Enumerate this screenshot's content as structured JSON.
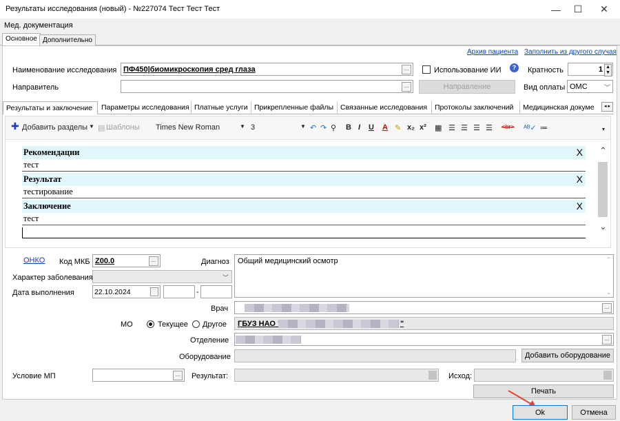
{
  "window": {
    "title": "Результаты исследования (новый) - №227074 Тест Тест Тест"
  },
  "menu": {
    "label": "Мед. документация"
  },
  "top_tabs": [
    "Основное",
    "Дополнительно"
  ],
  "links": {
    "archive": "Архив пациента",
    "fill_from": "Заполнить из другого случая"
  },
  "form": {
    "research_label": "Наименование исследования",
    "research_value": "ПФ450|биомикроскопия сред глаза",
    "ai_label": "Использование ИИ",
    "multiplicity_label": "Кратность",
    "multiplicity_value": "1",
    "referrer_label": "Направитель",
    "direction_btn": "Направление",
    "payment_label": "Вид оплаты",
    "payment_value": "ОМС"
  },
  "content_tabs": [
    "Результаты и заключение",
    "Параметры исследования",
    "Платные услуги",
    "Прикрепленные файлы",
    "Связанные исследования",
    "Протоколы заключений",
    "Медицинская докуме"
  ],
  "toolbar": {
    "add_sections": "Добавить разделы",
    "templates": "Шаблоны",
    "font": "Times New Roman",
    "size": "3"
  },
  "sections": [
    {
      "title": "Рекомендации",
      "text": "тест"
    },
    {
      "title": "Результат",
      "text": "тестирование"
    },
    {
      "title": "Заключение",
      "text": "тест"
    }
  ],
  "close_glyph": "X",
  "bottom": {
    "onko": "ОНКО",
    "mkb_label": "Код МКБ",
    "mkb_value": "Z00.0",
    "diagnosis_label": "Диагноз",
    "diagnosis_value": "Общий медицинский осмотр",
    "disease_char_label": "Характер заболевания",
    "date_label": "Дата выполнения",
    "date_value": "22.10.2024",
    "date_dash": "-",
    "doctor_label": "Врач",
    "mo_label": "МО",
    "mo_current": "Текущее",
    "mo_other": "Другое",
    "mo_value_prefix": "ГБУЗ НАО \"",
    "mo_value_suffix": "\"",
    "department_label": "Отделение",
    "equipment_label": "Оборудование",
    "add_equipment_btn": "Добавить оборудование",
    "condition_label": "Условие МП",
    "result_label": "Результат:",
    "outcome_label": "Исход:",
    "print_btn": "Печать"
  },
  "footer": {
    "ok": "Ok",
    "cancel": "Отмена"
  }
}
